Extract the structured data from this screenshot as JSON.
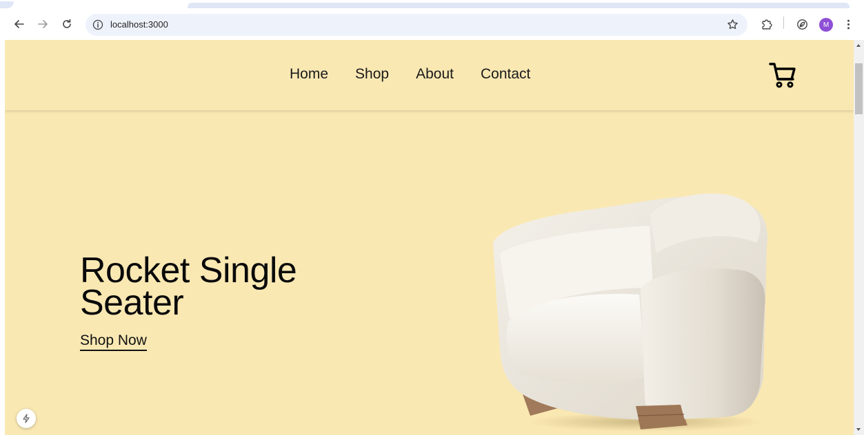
{
  "browser": {
    "url": "localhost:3000",
    "profile_initial": "M",
    "icons": {
      "back": "arrow-left-icon",
      "forward": "arrow-right-icon",
      "reload": "reload-icon",
      "info": "info-icon",
      "bookmark": "star-icon",
      "extensions": "puzzle-icon",
      "leaf": "leaf-icon",
      "menu": "kebab-menu-icon"
    }
  },
  "site": {
    "nav": [
      "Home",
      "Shop",
      "About",
      "Contact"
    ],
    "cart_icon": "cart-icon",
    "hero": {
      "title": "Rocket Single Seater",
      "cta": "Shop Now",
      "image": "armchair-image"
    },
    "colors": {
      "background": "#fae8b3",
      "text": "#0a0a0a"
    }
  }
}
